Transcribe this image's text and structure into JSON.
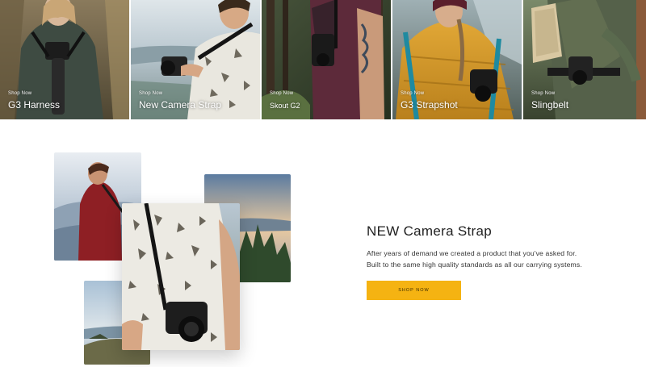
{
  "colors": {
    "accent": "#f5b312",
    "tile_text": "#ffffff",
    "heading": "#1f1f1f",
    "body_text": "#333333"
  },
  "categories": [
    {
      "eyebrow": "Shop Now",
      "name": "G3 Harness"
    },
    {
      "eyebrow": "Shop Now",
      "name": "New Camera Strap"
    },
    {
      "eyebrow": "Shop Now",
      "name": "Skout G2"
    },
    {
      "eyebrow": "Shop Now",
      "name": "G3 Strapshot"
    },
    {
      "eyebrow": "Shop Now",
      "name": "Slingbelt"
    }
  ],
  "promo": {
    "title": "NEW Camera Strap",
    "body_line1": "After years of demand we created a product that you've asked for.",
    "body_line2": "Built to the same high quality standards as all our  carrying systems.",
    "button_label": "SHOP NOW"
  }
}
